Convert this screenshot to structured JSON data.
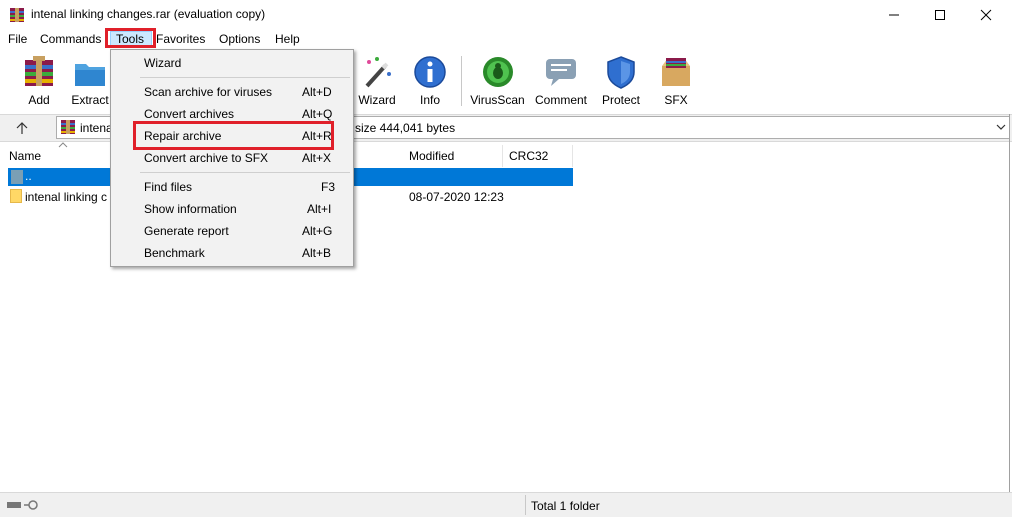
{
  "window": {
    "title": "intenal linking changes.rar (evaluation copy)",
    "minimize_icon": "minimize-icon",
    "maximize_icon": "maximize-icon",
    "close_icon": "close-icon"
  },
  "menubar": {
    "items": [
      "File",
      "Commands",
      "Tools",
      "Favorites",
      "Options",
      "Help"
    ]
  },
  "toolbar": {
    "buttons": [
      {
        "label": "Add",
        "icon": "add-archive-icon"
      },
      {
        "label": "Extract",
        "icon": "extract-icon"
      },
      {
        "label": "Wizard",
        "icon": "wizard-icon"
      },
      {
        "label": "Info",
        "icon": "info-icon"
      },
      {
        "label": "VirusScan",
        "icon": "virus-scan-icon"
      },
      {
        "label": "Comment",
        "icon": "comment-icon"
      },
      {
        "label": "Protect",
        "icon": "protect-icon"
      },
      {
        "label": "SFX",
        "icon": "sfx-icon"
      }
    ]
  },
  "address": {
    "path": "intena",
    "size_text": "size 444,041 bytes"
  },
  "columns": {
    "name": "Name",
    "modified": "Modified",
    "crc": "CRC32"
  },
  "rows": [
    {
      "name": "..",
      "modified": ""
    },
    {
      "name": "intenal linking c",
      "modified": "08-07-2020 12:23"
    }
  ],
  "tools_menu": {
    "items": [
      {
        "label": "Wizard",
        "shortcut": ""
      },
      {
        "label": "Scan archive for viruses",
        "shortcut": "Alt+D"
      },
      {
        "label": "Convert archives",
        "shortcut": "Alt+Q"
      },
      {
        "label": "Repair archive",
        "shortcut": "Alt+R"
      },
      {
        "label": "Convert archive to SFX",
        "shortcut": "Alt+X"
      },
      {
        "label": "Find files",
        "shortcut": "F3"
      },
      {
        "label": "Show information",
        "shortcut": "Alt+I"
      },
      {
        "label": "Generate report",
        "shortcut": "Alt+G"
      },
      {
        "label": "Benchmark",
        "shortcut": "Alt+B"
      }
    ]
  },
  "status": {
    "text": "Total 1 folder"
  },
  "colors": {
    "highlight_red": "#e0202a",
    "selection_blue": "#0078d7"
  }
}
